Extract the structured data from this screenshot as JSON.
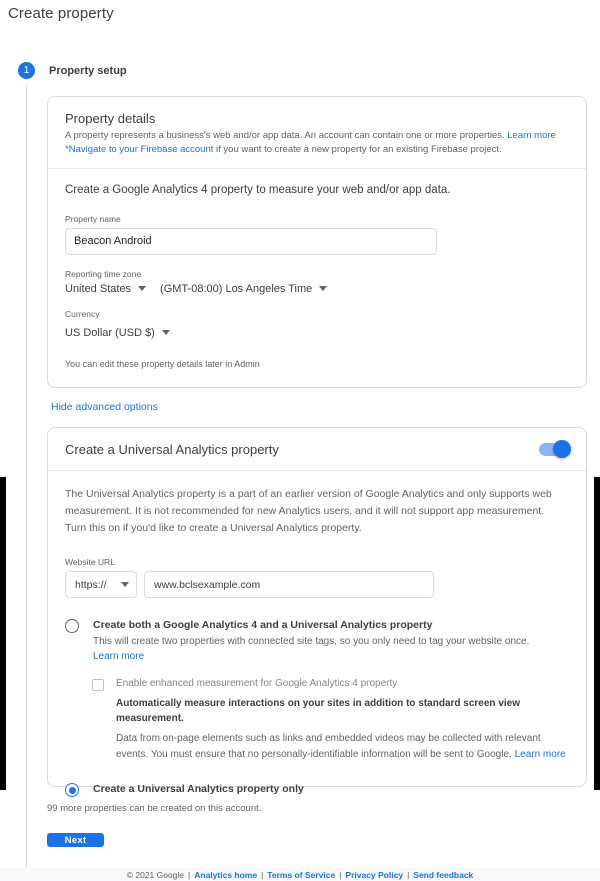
{
  "page_title": "Create property",
  "step": {
    "number": "1",
    "label": "Property setup"
  },
  "property_details": {
    "heading": "Property details",
    "desc_part1": "A property represents a business's web and/or app data. An account can contain one or more properties. ",
    "learn_more": "Learn more",
    "firebase_link": "*Navigate to your Firebase account",
    "desc_part2": " if you want to create a new property for an existing Firebase project.",
    "lead": "Create a Google Analytics 4 property to measure your web and/or app data.",
    "property_name_label": "Property name",
    "property_name_value": "Beacon Android",
    "property_name_placeholder": "Property name",
    "timezone_label": "Reporting time zone",
    "timezone_country": "United States",
    "timezone_offset": "(GMT-08:00) Los Angeles Time",
    "currency_label": "Currency",
    "currency_value": "US Dollar (USD $)",
    "edit_hint": "You can edit these property details later in Admin"
  },
  "hide_advanced_options": "Hide advanced options",
  "universal_analytics": {
    "heading": "Create a Universal Analytics property",
    "toggle_state": "on",
    "description": "The Universal Analytics property is a part of an earlier version of Google Analytics and only supports web measurement. It is not recommended for new Analytics users, and it will not support app measurement. Turn this on if you'd like to create a Universal Analytics property.",
    "website_url_label": "Website URL",
    "protocol_value": "https://",
    "url_value": "www.bclsexample.com",
    "url_placeholder": "www.example.com",
    "option_both": {
      "title": "Create both a Google Analytics 4 and a Universal Analytics property",
      "sub": "This will create two properties with connected site tags, so you only need to tag your website once.",
      "learn_more": "Learn more",
      "selected": false
    },
    "enhanced_measurement": {
      "checkbox_label": "Enable enhanced measurement for Google Analytics 4 property",
      "bold_text": "Automatically measure interactions on your sites in addition to standard screen view measurement.",
      "desc": "Data from on-page elements such as links and embedded videos may be collected with relevant events. You must ensure that no personally-identifiable information will be sent to Google. ",
      "learn_more": "Learn more",
      "checked": false
    },
    "option_ua_only": {
      "title": "Create a Universal Analytics property only",
      "selected": true
    }
  },
  "properties_note": "99 more properties can be created on this account.",
  "next_button": "Next",
  "footer": {
    "copyright": "© 2021 Google",
    "links": [
      "Analytics home",
      "Terms of Service",
      "Privacy Policy",
      "Send feedback"
    ]
  },
  "colors": {
    "accent": "#1a73e8",
    "toggle_track": "#8ab4f8",
    "text_primary": "#3c4043",
    "text_secondary": "#5f6368",
    "border": "#dadce0"
  }
}
